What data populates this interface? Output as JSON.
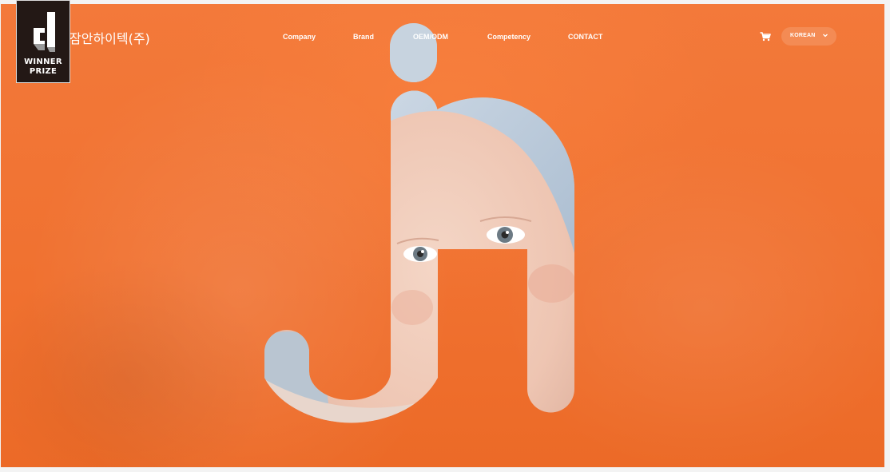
{
  "badge": {
    "line1": "WINNER",
    "line2": "PRIZE",
    "icon": "winner-prize-logo-icon"
  },
  "header": {
    "company_name": "잠안하이텍(주)"
  },
  "nav": {
    "items": [
      {
        "label": "Company"
      },
      {
        "label": "Brand"
      },
      {
        "label": "OEM/ODM"
      },
      {
        "label": "Competency"
      },
      {
        "label": "CONTACT"
      }
    ]
  },
  "utility": {
    "cart_icon": "cart-icon",
    "language": "KOREAN",
    "language_icon": "chevron-down-icon"
  },
  "hero": {
    "background_color": "#f0772f",
    "letters_icon": "ja-logo-letters-with-baby-photo"
  },
  "colors": {
    "accent": "#f0772f",
    "badge_bg": "#231815",
    "text": "#ffffff"
  }
}
